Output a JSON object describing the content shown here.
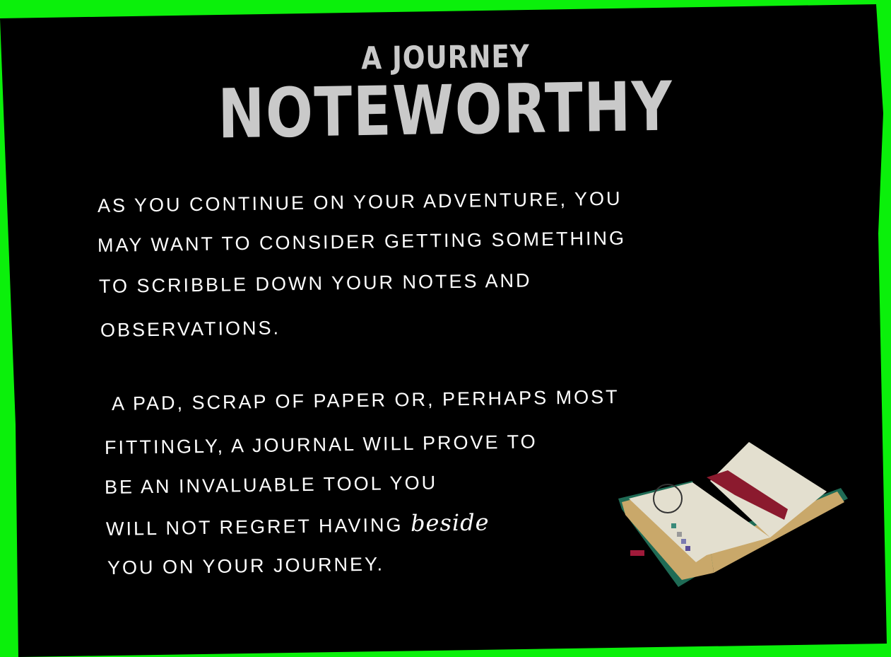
{
  "card": {
    "subtitle": "A JOURNEY",
    "title": "NOTEWORTHY",
    "paragraph1": [
      "As you continue on your adventure, you",
      "may want to consider getting something",
      "to scribble down your notes and",
      "observations."
    ],
    "paragraph2": [
      "A pad, scrap of paper or, perhaps most",
      "fittingly, a journal will prove to",
      "be an invaluable tool you",
      "will not regret having"
    ],
    "paragraph2_emphasis": "beside",
    "paragraph2_last": "you on your journey.",
    "illustration": "open-journal-icon"
  },
  "colors": {
    "background": "#0bf00b",
    "card": "#000000",
    "title": "#c9c9c9",
    "text": "#ffffff"
  }
}
